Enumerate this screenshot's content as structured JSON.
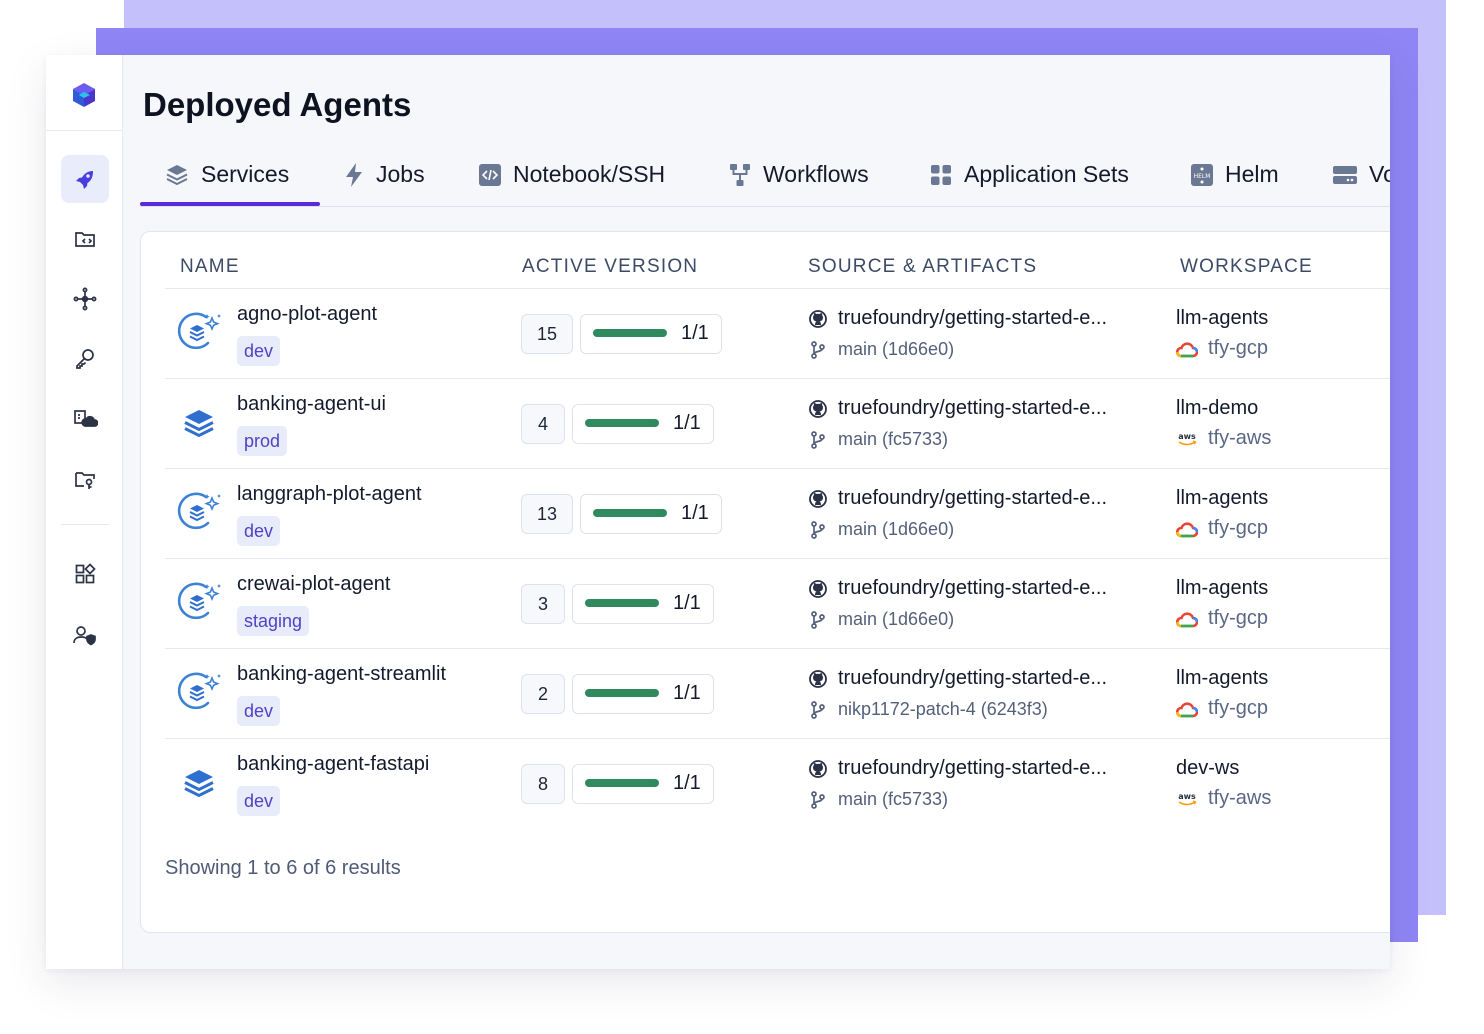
{
  "app": {
    "title": "Deployed Agents"
  },
  "sidebar": {
    "logo": "truefoundry-logo-icon",
    "items": [
      {
        "icon": "rocket-icon",
        "active": true
      },
      {
        "icon": "code-folder-icon",
        "active": false
      },
      {
        "icon": "network-icon",
        "active": false
      },
      {
        "icon": "key-icon",
        "active": false
      },
      {
        "icon": "cloud-cluster-icon",
        "active": false
      },
      {
        "icon": "folder-access-icon",
        "active": false
      },
      {
        "icon": "widgets-icon",
        "active": false
      },
      {
        "icon": "user-shield-icon",
        "active": false
      }
    ]
  },
  "tabs": [
    {
      "label": "Services",
      "icon": "stack-icon",
      "active": true
    },
    {
      "label": "Jobs",
      "icon": "bolt-icon"
    },
    {
      "label": "Notebook/SSH",
      "icon": "code-box-icon"
    },
    {
      "label": "Workflows",
      "icon": "workflow-icon"
    },
    {
      "label": "Application Sets",
      "icon": "grid-icon"
    },
    {
      "label": "Helm",
      "icon": "helm-icon"
    },
    {
      "label": "Vo",
      "icon": "volume-icon"
    }
  ],
  "table": {
    "columns": [
      "NAME",
      "ACTIVE VERSION",
      "SOURCE & ARTIFACTS",
      "WORKSPACE"
    ],
    "rows": [
      {
        "name": "agno-plot-agent",
        "env": "dev",
        "type": "agent",
        "version": "15",
        "replicas": "1/1",
        "ready_fraction": 1,
        "source": "truefoundry/getting-started-e...",
        "branch": "main (1d66e0)",
        "workspace": "llm-agents",
        "cluster": "tfy-gcp",
        "cloud": "gcp"
      },
      {
        "name": "banking-agent-ui",
        "env": "prod",
        "type": "service",
        "version": "4",
        "replicas": "1/1",
        "ready_fraction": 1,
        "source": "truefoundry/getting-started-e...",
        "branch": "main (fc5733)",
        "workspace": "llm-demo",
        "cluster": "tfy-aws",
        "cloud": "aws"
      },
      {
        "name": "langgraph-plot-agent",
        "env": "dev",
        "type": "agent",
        "version": "13",
        "replicas": "1/1",
        "ready_fraction": 1,
        "source": "truefoundry/getting-started-e...",
        "branch": "main (1d66e0)",
        "workspace": "llm-agents",
        "cluster": "tfy-gcp",
        "cloud": "gcp"
      },
      {
        "name": "crewai-plot-agent",
        "env": "staging",
        "type": "agent",
        "version": "3",
        "replicas": "1/1",
        "ready_fraction": 1,
        "source": "truefoundry/getting-started-e...",
        "branch": "main (1d66e0)",
        "workspace": "llm-agents",
        "cluster": "tfy-gcp",
        "cloud": "gcp"
      },
      {
        "name": "banking-agent-streamlit",
        "env": "dev",
        "type": "agent",
        "version": "2",
        "replicas": "1/1",
        "ready_fraction": 1,
        "source": "truefoundry/getting-started-e...",
        "branch": "nikp1172-patch-4 (6243f3)",
        "workspace": "llm-agents",
        "cluster": "tfy-gcp",
        "cloud": "gcp"
      },
      {
        "name": "banking-agent-fastapi",
        "env": "dev",
        "type": "service",
        "version": "8",
        "replicas": "1/1",
        "ready_fraction": 1,
        "source": "truefoundry/getting-started-e...",
        "branch": "main (fc5733)",
        "workspace": "dev-ws",
        "cluster": "tfy-aws",
        "cloud": "aws"
      }
    ]
  },
  "footer": {
    "results": "Showing 1 to 6 of 6 results"
  },
  "colors": {
    "accent": "#5b2bd9",
    "progress": "#2f8a5e",
    "badge_bg": "#e8ebfa",
    "badge_text": "#5340c5",
    "backdrop_light": "#c4c0fb",
    "backdrop_dark": "#8f85f5"
  }
}
